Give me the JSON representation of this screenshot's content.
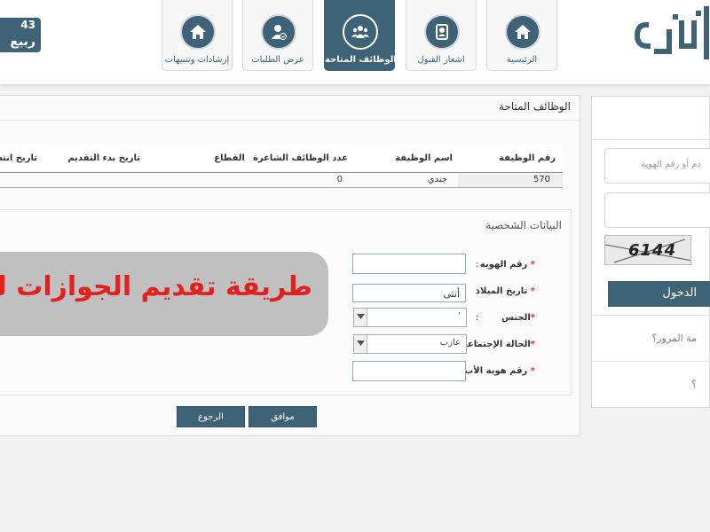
{
  "header": {
    "date_line1": "43",
    "date_line2": "ربيع",
    "logo_text": "وظائف"
  },
  "nav": [
    {
      "label": "الرئيسية",
      "icon": "home-icon",
      "active": false
    },
    {
      "label": "اشعار القبول",
      "icon": "notification-icon",
      "active": false
    },
    {
      "label": "الوظائف المتاحة",
      "icon": "group-icon",
      "active": true
    },
    {
      "label": "عرض الطلبات",
      "icon": "user-check-icon",
      "active": false
    },
    {
      "label": "إرشادات وتنبيهات",
      "icon": "home-icon",
      "active": false
    }
  ],
  "side": {
    "id_placeholder": "دم أو رقم الهوية",
    "captcha_text": "6144",
    "login_label": "الدخول",
    "forgot_password": "مة المرور؟",
    "other_link": "؟"
  },
  "main": {
    "panel_title": "الوظائف المتاحة",
    "table": {
      "headers": [
        "رقم الوظيفة",
        "اسم الوظيفة",
        "عدد الوظائف الشاغرة",
        "القطاع",
        "تاريخ بدء التقديم",
        "تاريخ انته"
      ],
      "rows": [
        [
          "570",
          "جندي",
          "0",
          "",
          "",
          ""
        ]
      ]
    },
    "personal": {
      "title": "البيانات الشخصية",
      "fields": [
        {
          "label": "رقم الهوية",
          "value": ""
        },
        {
          "label": "تاريخ الميلاد",
          "value": "أنثى"
        },
        {
          "label": "الجنس",
          "value": "'"
        },
        {
          "label": "الحالة الإجتماعية",
          "value": "عازب"
        },
        {
          "label": "رقم هوية الأب",
          "value": ""
        }
      ],
      "colon": ":",
      "required_mark": "*"
    },
    "buttons": {
      "agree": "موافق",
      "back": "الرجوع"
    }
  },
  "banner": {
    "text": "طريقة تقديم الجوازات للنسا"
  },
  "colors": {
    "primary": "#3e6377",
    "banner_text": "#e01515",
    "banner_bg": "#bdbdbd"
  }
}
